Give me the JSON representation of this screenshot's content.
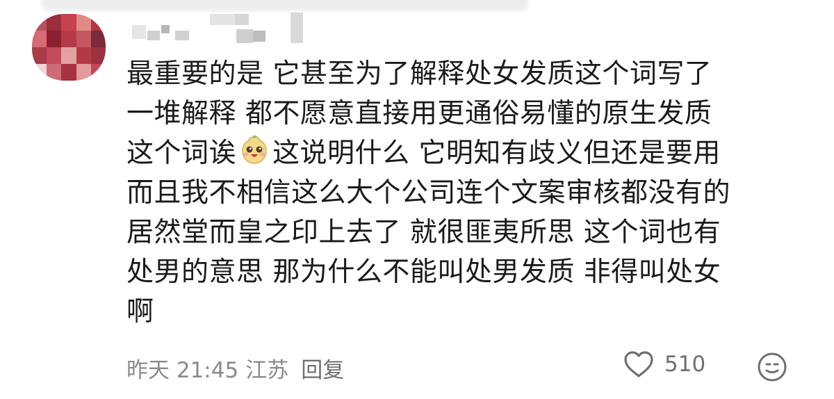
{
  "comment": {
    "username_hidden": true,
    "lines": [
      "最重要的是 它甚至为了解释处女发质这个词写了",
      "一堆解释 都不愿意直接用更通俗易懂的原生发质",
      "这个词诶",
      "这说明什么 它明知有歧义但还是要用",
      "而且我不相信这么大个公司连个文案审核都没有的",
      "居然堂而皇之印上去了 就很匪夷所思  这个词也有",
      "处男的意思 那为什么不能叫处男发质 非得叫处女",
      "啊"
    ],
    "inline_emoji": "smiling-bun-emoji",
    "time": "昨天 21:45",
    "location": "江苏",
    "reply_label": "回复",
    "like_count": "510"
  },
  "colors": {
    "text": "#1b1b1b",
    "meta": "#8a8a8a",
    "icon": "#6f6f6f"
  },
  "icons": {
    "like": "heart-outline-icon",
    "react": "smiley-face-icon"
  }
}
